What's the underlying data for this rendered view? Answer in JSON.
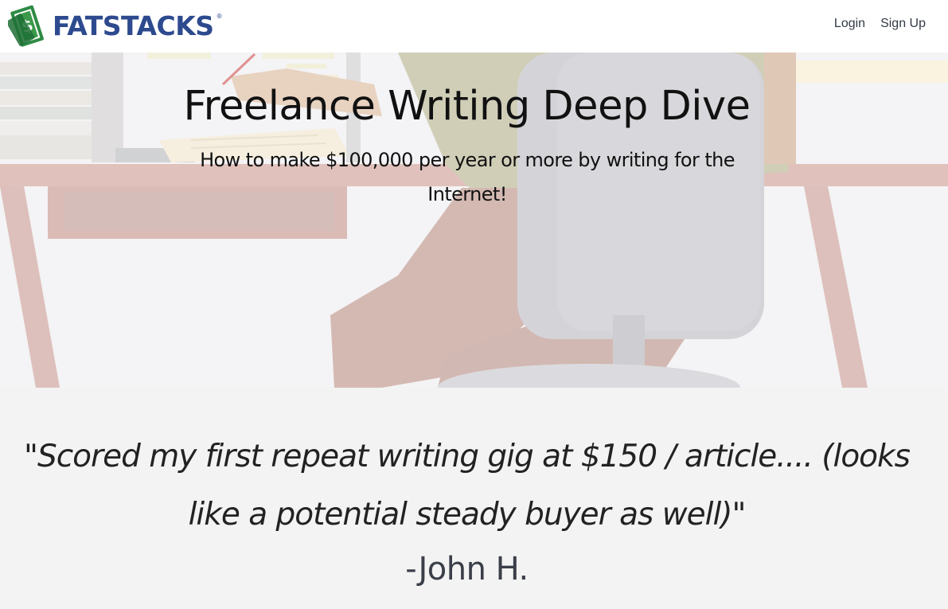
{
  "header": {
    "logo_text": "FATSTACKS",
    "logo_mark": "®",
    "nav": {
      "login": "Login",
      "signup": "Sign Up"
    }
  },
  "hero": {
    "title": "Freelance Writing Deep Dive",
    "subtitle": "How to make $100,000 per year or more by writing for the Internet!",
    "illustration": "person-writing-at-desk-illustration"
  },
  "testimonial": {
    "quote": "\"Scored my first repeat writing gig at $150 / article.... (looks like a potential steady buyer as well)\"",
    "author": "-John H."
  },
  "colors": {
    "brand_blue": "#2d4a8e",
    "brand_green": "#3a9a4a"
  }
}
